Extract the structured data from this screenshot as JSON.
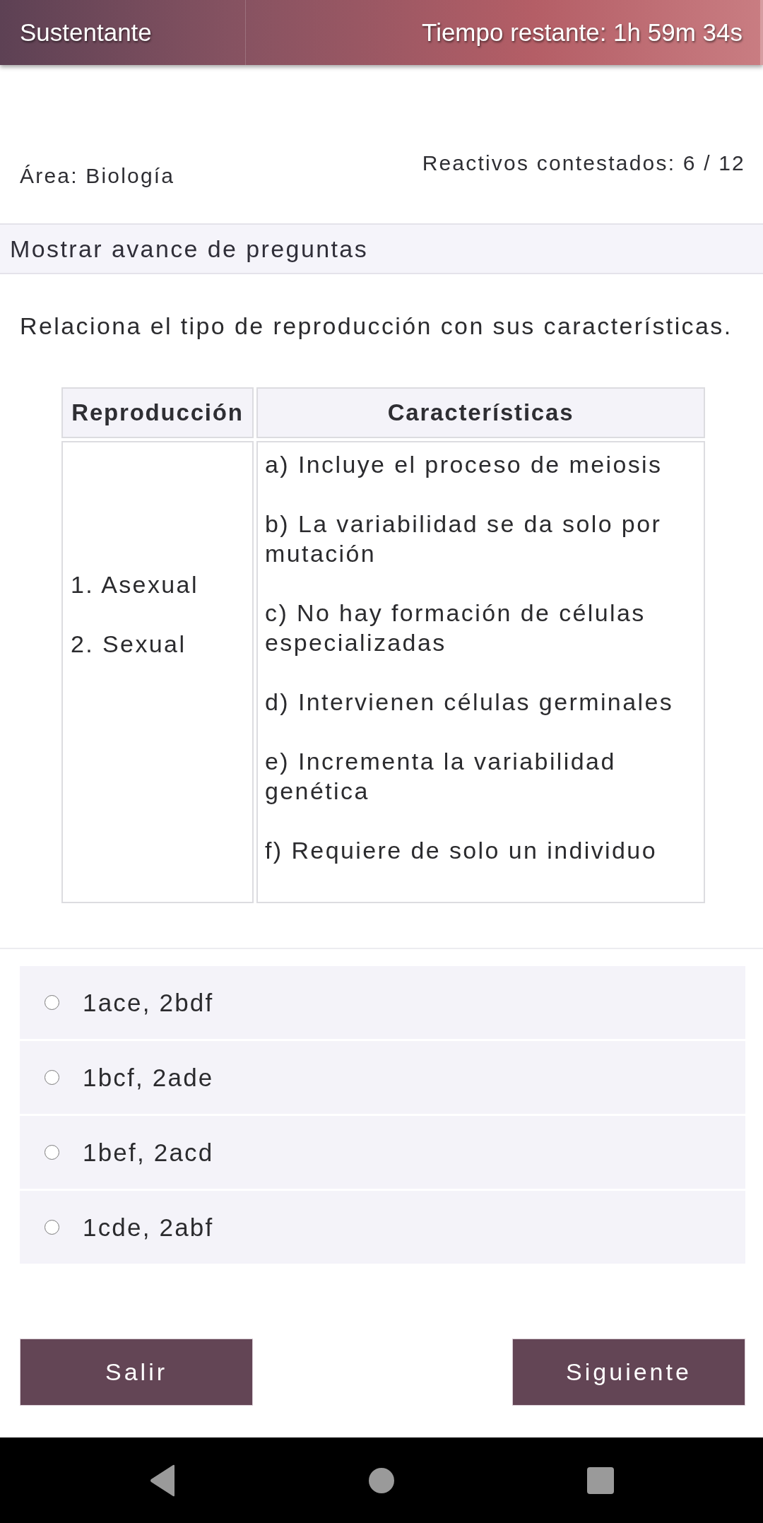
{
  "header": {
    "title": "Sustentante",
    "timer": "Tiempo restante: 1h 59m 34s"
  },
  "info": {
    "area": "Área: Biología",
    "answered": "Reactivos contestados: 6 / 12"
  },
  "progress_toggle": {
    "label": "Mostrar avance de preguntas"
  },
  "question": {
    "prompt": "Relaciona el tipo de reproducción con sus características.",
    "table": {
      "columns": [
        "Reproducción",
        "Características"
      ],
      "rows": [
        {
          "types": [
            "1. Asexual",
            "2. Sexual"
          ],
          "characteristics": [
            "a) Incluye el proceso de meiosis",
            "b) La variabilidad se da solo por mutación",
            "c) No hay formación de células especializadas",
            "d) Intervienen células germinales",
            "e) Incrementa la variabilidad genética",
            "f) Requiere de solo un individuo"
          ]
        }
      ]
    }
  },
  "options": [
    {
      "label": "1ace, 2bdf",
      "selected": false
    },
    {
      "label": "1bcf, 2ade",
      "selected": false
    },
    {
      "label": "1bef, 2acd",
      "selected": false
    },
    {
      "label": "1cde, 2abf",
      "selected": false
    }
  ],
  "buttons": [
    "Salir",
    "Siguiente"
  ]
}
